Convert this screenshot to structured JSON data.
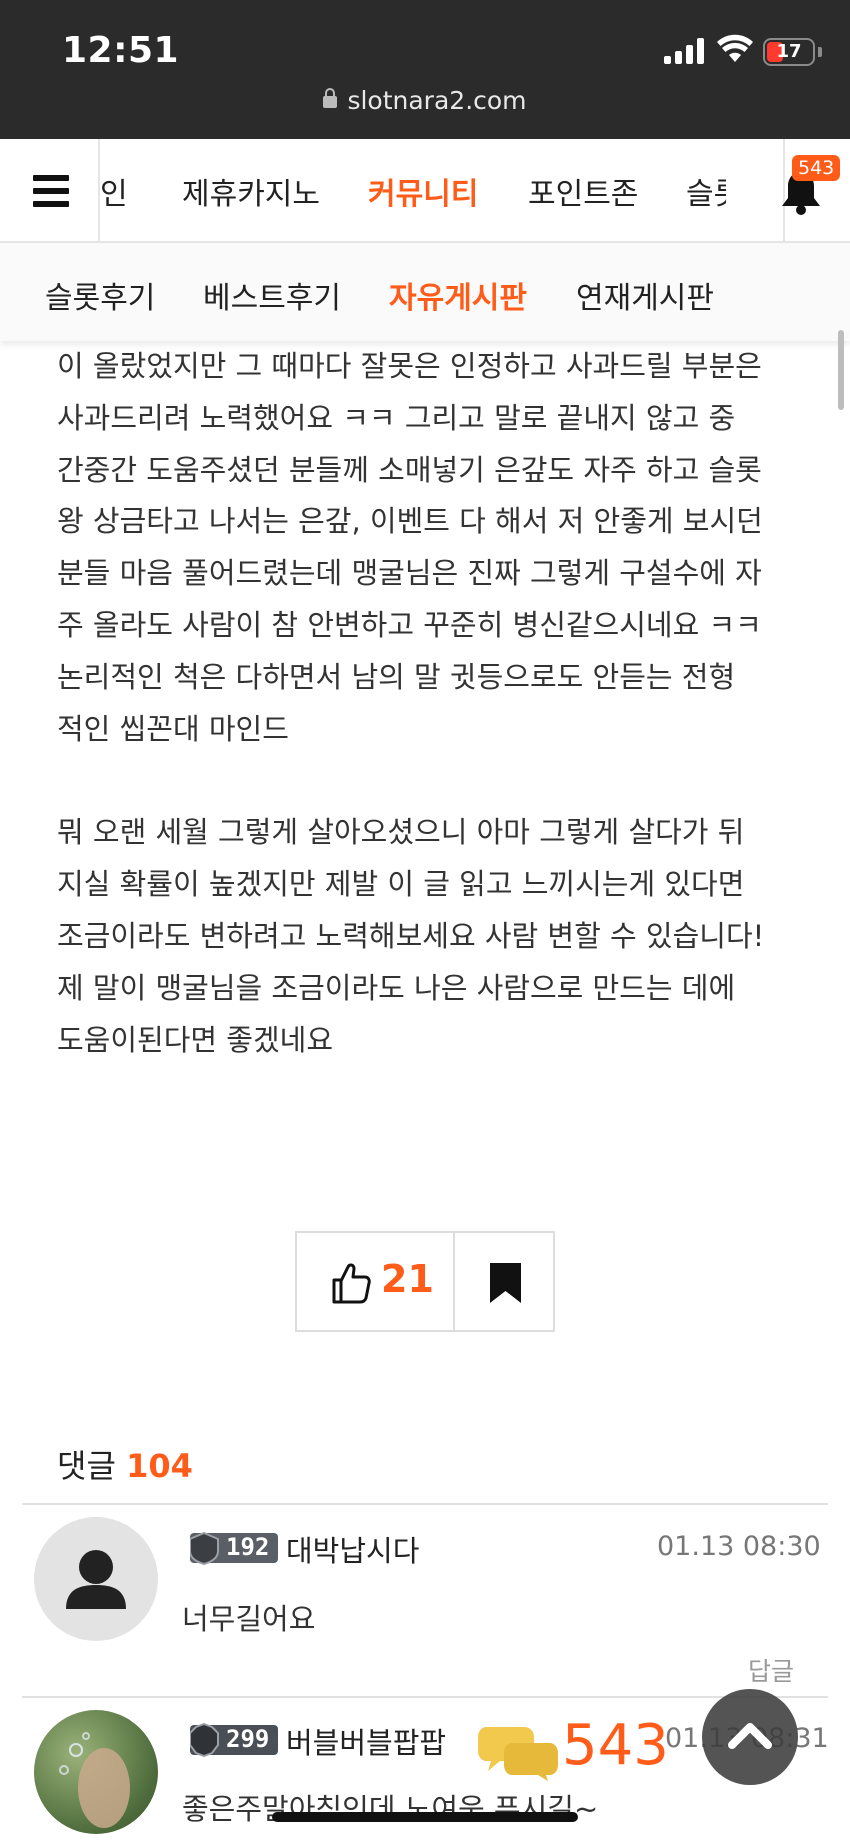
{
  "status_bar": {
    "time": "12:51",
    "battery": "17",
    "url": "slotnara2.com"
  },
  "nav": {
    "items": [
      "인",
      "제휴카지노",
      "커뮤니티",
      "포인트존",
      "슬롯"
    ],
    "active": "커뮤니티",
    "notification_count": "543"
  },
  "subnav": {
    "items": [
      "슬롯후기",
      "베스트후기",
      "자유게시판",
      "연재게시판"
    ],
    "active": "자유게시판"
  },
  "article": {
    "lines_p1": [
      "이 올랐었지만 그 때마다 잘못은 인정하고 사과드릴 부분은",
      " 사과드리려 노력했어요 ㅋㅋ 그리고 말로 끝내지 않고 중",
      "간중간 도움주셨던 분들께 소매넣기 은갚도 자주 하고 슬롯",
      "왕 상금타고 나서는 은갚, 이벤트 다 해서 저 안좋게 보시던",
      "분들 마음 풀어드렸는데 맹굴님은 진짜 그렇게 구설수에 자",
      "주 올라도 사람이 참 안변하고 꾸준히 병신같으시네요 ㅋㅋ",
      " 논리적인 척은 다하면서 남의 말 귓등으로도 안듣는 전형",
      "적인 씹꼰대 마인드"
    ],
    "lines_p2": [
      "뭐 오랜 세월 그렇게 살아오셨으니 아마 그렇게 살다가 뒤",
      "지실 확률이 높겠지만 제발 이 글 읽고 느끼시는게 있다면",
      "조금이라도 변하려고 노력해보세요 사람 변할 수 있습니다!",
      " 제 말이 맹굴님을 조금이라도 나은 사람으로 만드는 데에",
      "도움이된다면 좋겠네요"
    ]
  },
  "actions": {
    "like_count": "21"
  },
  "comments": {
    "label": "댓글",
    "count": "104",
    "items": [
      {
        "level": "192",
        "author": "대박납시다",
        "date": "01.13 08:30",
        "text": "너무길어요",
        "reply_label": "답글"
      },
      {
        "level": "299",
        "author": "버블버블팝팝",
        "date": "01.13 08:31",
        "text": "좋은주말아침인데 노여움 푸시길~"
      }
    ]
  },
  "floating": {
    "chat_count": "543"
  },
  "colors": {
    "accent": "#ff5c1a",
    "statusbar": "#2b2b2b"
  }
}
